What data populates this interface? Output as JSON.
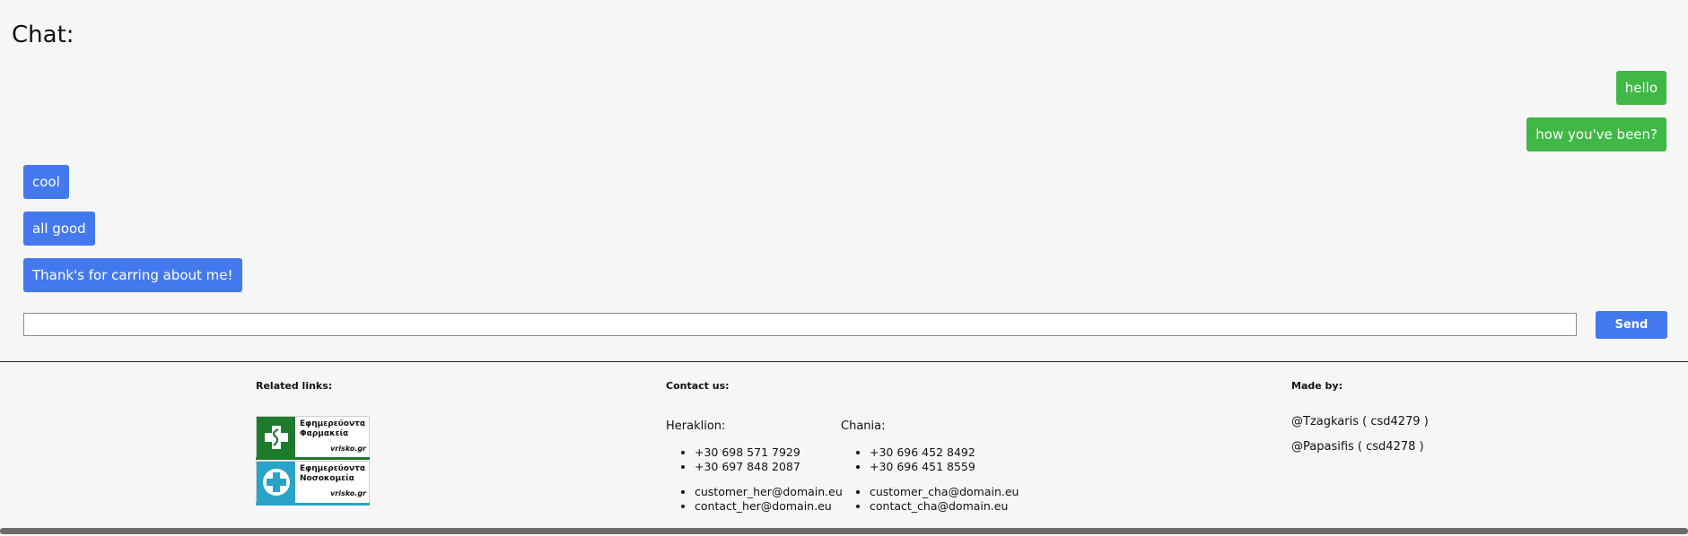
{
  "chat": {
    "title": "Chat:",
    "messages": [
      {
        "text": "hello",
        "side": "sent"
      },
      {
        "text": "how you've been?",
        "side": "sent"
      },
      {
        "text": "cool",
        "side": "received"
      },
      {
        "text": "all good",
        "side": "received"
      },
      {
        "text": "Thank's for carring about me!",
        "side": "received"
      }
    ],
    "input_value": "",
    "send_label": "Send"
  },
  "footer": {
    "related_links": {
      "heading": "Related links:",
      "badges": [
        {
          "line1": "Εφημερεύοντα",
          "line2": "Φαρμακεία",
          "brand": "vrisko.gr",
          "icon": "pharmacy-cross-icon"
        },
        {
          "line1": "Εφημερεύοντα",
          "line2": "Νοσοκομεία",
          "brand": "vrisko.gr",
          "icon": "hospital-cross-icon"
        }
      ]
    },
    "contact": {
      "heading": "Contact us:",
      "heraklion": {
        "label": "Heraklion:",
        "phones": [
          "+30 698 571 7929",
          "+30 697 848 2087"
        ],
        "emails": [
          "customer_her@domain.eu",
          "contact_her@domain.eu"
        ]
      },
      "chania": {
        "label": "Chania:",
        "phones": [
          "+30 696 452 8492",
          "+30 696 451 8559"
        ],
        "emails": [
          "customer_cha@domain.eu",
          "contact_cha@domain.eu"
        ]
      }
    },
    "made_by": {
      "heading": "Made by:",
      "authors": [
        "@Tzagkaris ( csd4279 )",
        "@Papasifis ( csd4278 )"
      ]
    }
  },
  "colors": {
    "sent_bubble": "#3fb845",
    "received_bubble": "#4479ee",
    "send_button": "#4479ee",
    "background": "#f6f6f6"
  }
}
